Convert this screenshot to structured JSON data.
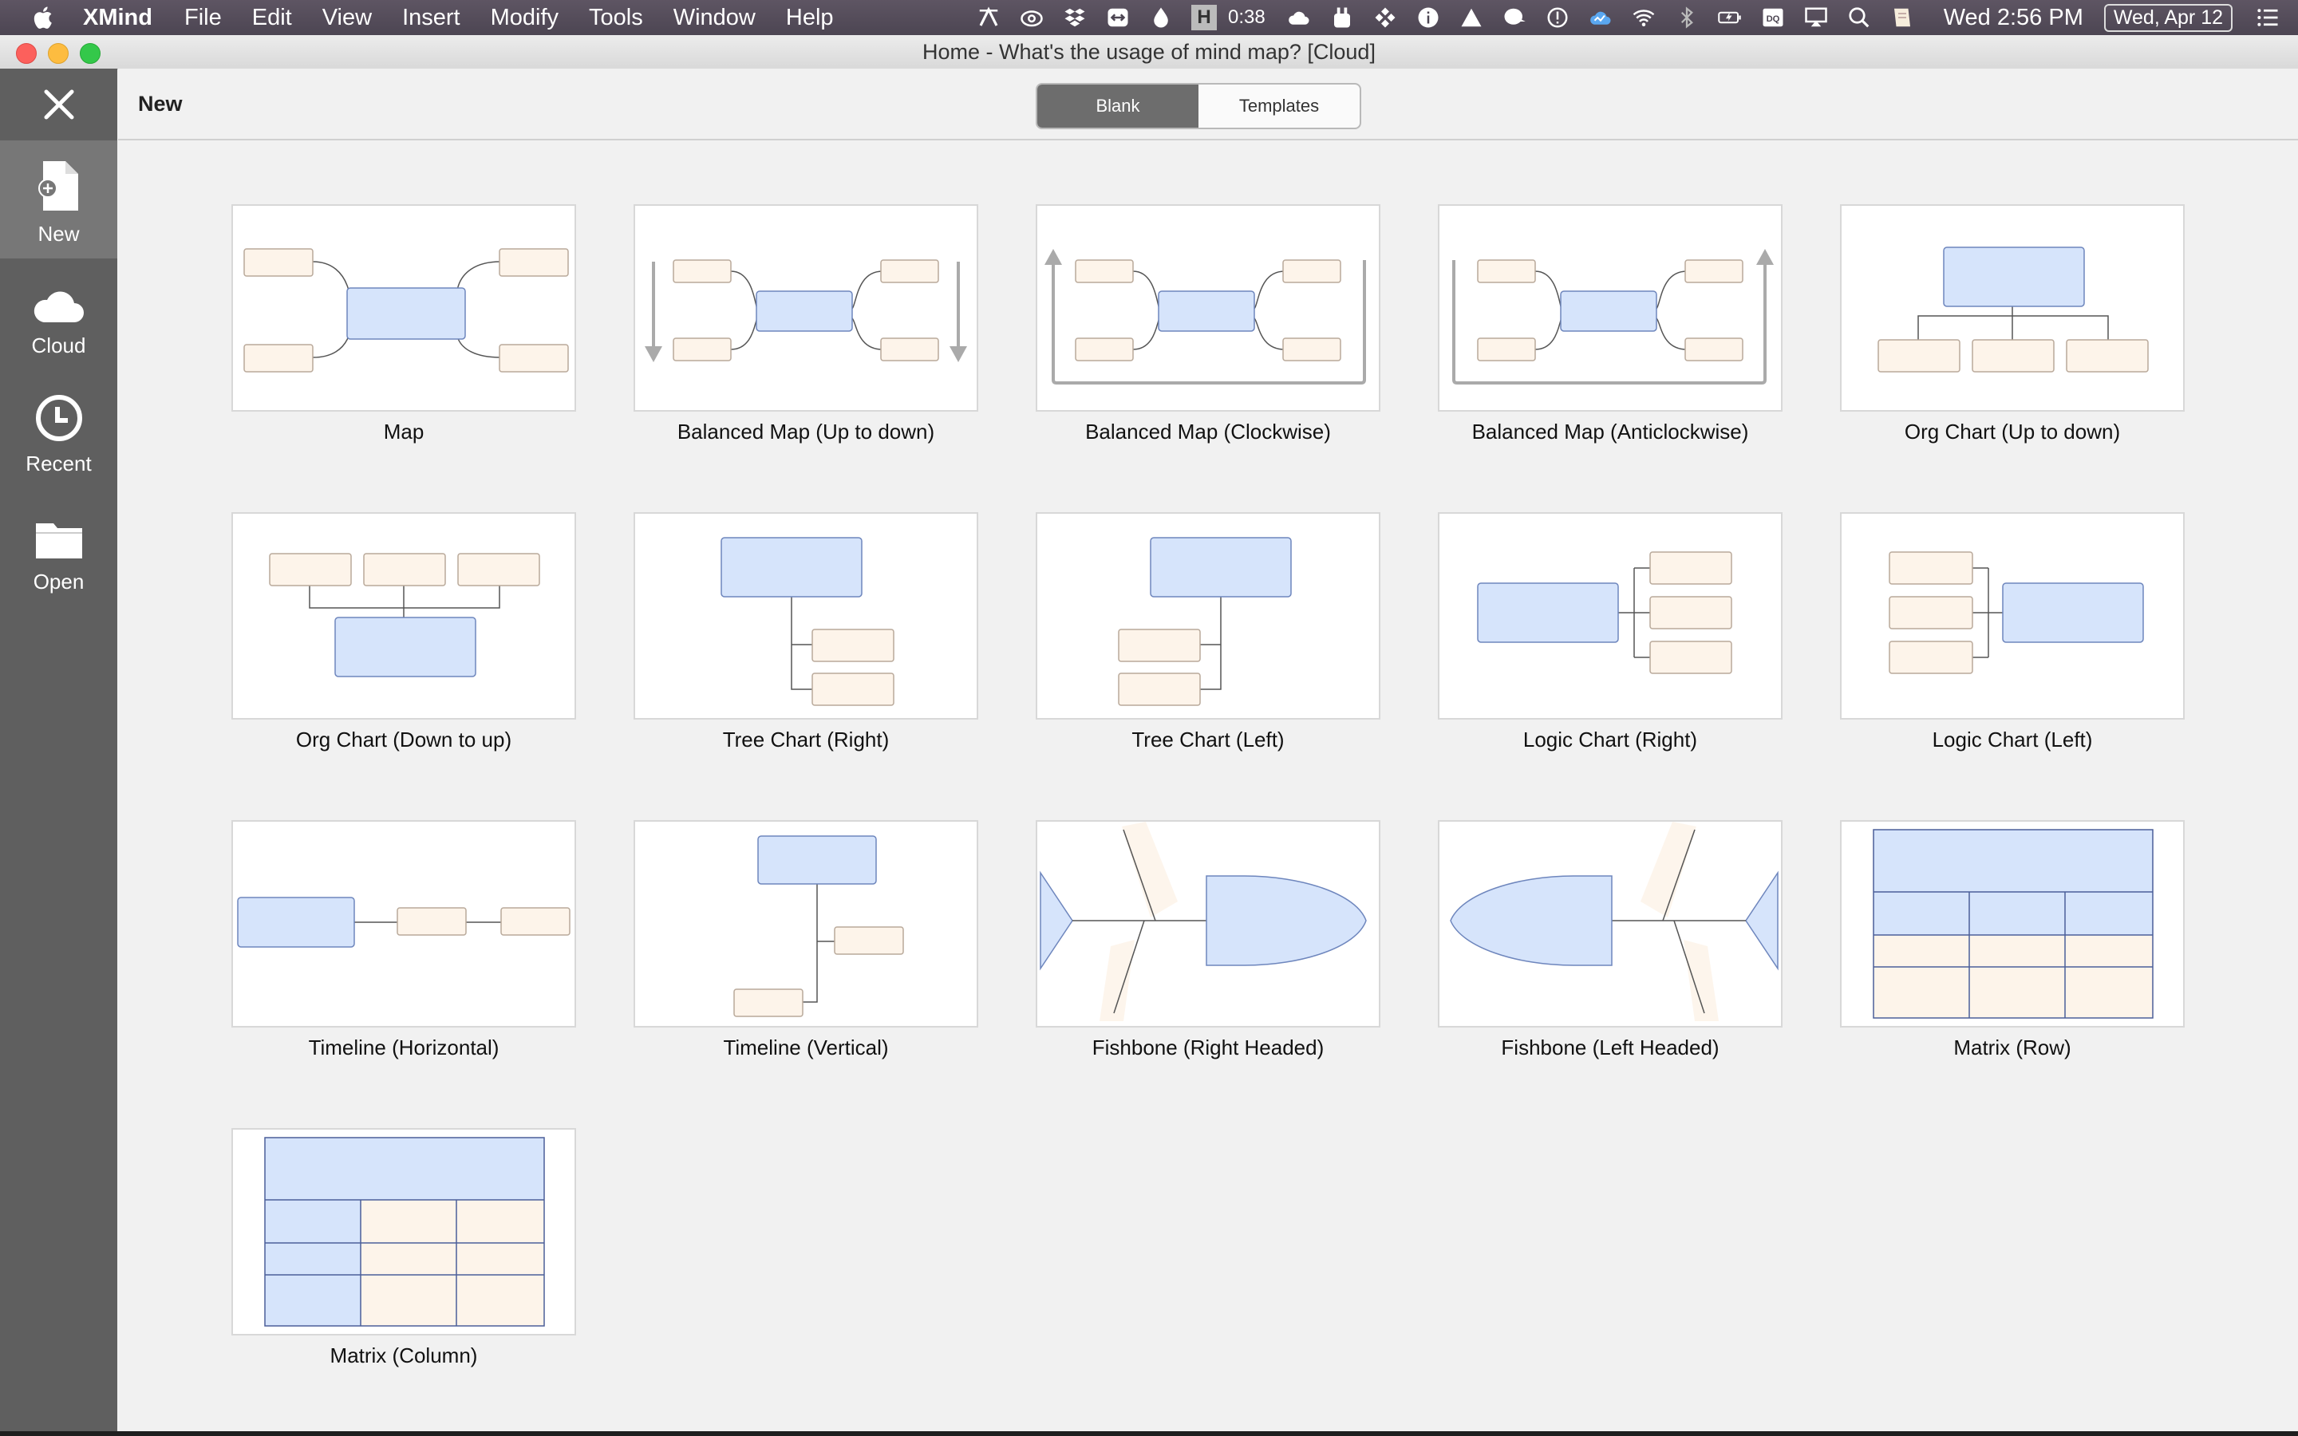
{
  "menubar": {
    "app_name": "XMind",
    "menus": [
      "File",
      "Edit",
      "View",
      "Insert",
      "Modify",
      "Tools",
      "Window",
      "Help"
    ],
    "timer": "0:38",
    "clock": "Wed 2:56 PM",
    "date_badge": "Wed, Apr 12",
    "h_badge": "H"
  },
  "window": {
    "title": "Home - What's the usage of mind map? [Cloud]"
  },
  "sidebar": {
    "items": [
      {
        "label": "New",
        "icon": "new-file-icon",
        "active": true
      },
      {
        "label": "Cloud",
        "icon": "cloud-icon",
        "active": false
      },
      {
        "label": "Recent",
        "icon": "clock-icon",
        "active": false
      },
      {
        "label": "Open",
        "icon": "folder-icon",
        "active": false
      }
    ]
  },
  "toolbar": {
    "heading": "New",
    "segments": [
      {
        "label": "Blank",
        "active": true
      },
      {
        "label": "Templates",
        "active": false
      }
    ]
  },
  "templates": [
    {
      "label": "Map"
    },
    {
      "label": "Balanced Map (Up to down)"
    },
    {
      "label": "Balanced Map (Clockwise)"
    },
    {
      "label": "Balanced Map (Anticlockwise)"
    },
    {
      "label": "Org Chart (Up to down)"
    },
    {
      "label": "Org Chart (Down to up)"
    },
    {
      "label": "Tree Chart (Right)"
    },
    {
      "label": "Tree Chart (Left)"
    },
    {
      "label": "Logic Chart (Right)"
    },
    {
      "label": "Logic Chart (Left)"
    },
    {
      "label": "Timeline (Horizontal)"
    },
    {
      "label": "Timeline (Vertical)"
    },
    {
      "label": "Fishbone (Right Headed)"
    },
    {
      "label": "Fishbone (Left Headed)"
    },
    {
      "label": "Matrix (Row)"
    },
    {
      "label": "Matrix (Column)"
    }
  ],
  "colors": {
    "central_topic": "#d6e4fb",
    "central_border": "#6e86bd",
    "subtopic": "#fdf4ea",
    "subtopic_border": "#b9a99a",
    "sidebar_bg": "#5f5f5f",
    "sidebar_active": "#777777"
  }
}
